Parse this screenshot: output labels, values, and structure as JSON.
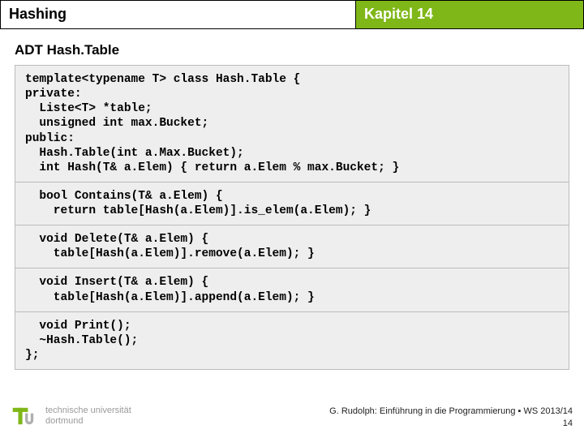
{
  "header": {
    "left": "Hashing",
    "right": "Kapitel 14"
  },
  "subtitle": "ADT Hash.Table",
  "code": {
    "s1": "template<typename T> class Hash.Table {\nprivate:\n  Liste<T> *table;\n  unsigned int max.Bucket;\npublic:\n  Hash.Table(int a.Max.Bucket);\n  int Hash(T& a.Elem) { return a.Elem % max.Bucket; }",
    "s2": "  bool Contains(T& a.Elem) {\n    return table[Hash(a.Elem)].is_elem(a.Elem); }",
    "s3": "  void Delete(T& a.Elem) {\n    table[Hash(a.Elem)].remove(a.Elem); }",
    "s4": "  void Insert(T& a.Elem) {\n    table[Hash(a.Elem)].append(a.Elem); }",
    "s5": "  void Print();\n  ~Hash.Table();\n};"
  },
  "footer": {
    "uni_line1": "technische universität",
    "uni_line2": "dortmund",
    "credit_line": "G. Rudolph: Einführung in die Programmierung ▪ WS 2013/14",
    "page_num": "14"
  }
}
